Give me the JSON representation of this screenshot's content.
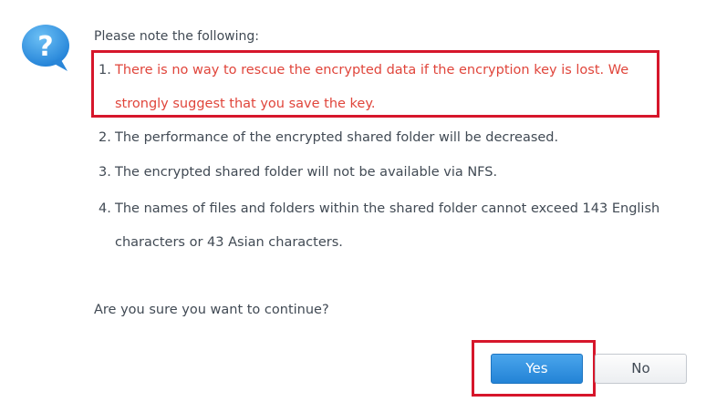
{
  "dialog": {
    "intro": "Please note the following:",
    "items": [
      {
        "num": "1.",
        "lines": [
          "There is no way to rescue the encrypted data if the encryption key is lost. We",
          "strongly suggest that you save the key."
        ]
      },
      {
        "num": "2.",
        "lines": [
          "The performance of the encrypted shared folder will be decreased."
        ]
      },
      {
        "num": "3.",
        "lines": [
          "The encrypted shared folder will not be available via NFS."
        ]
      },
      {
        "num": "4.",
        "lines": [
          "The names of files and folders within the shared folder cannot exceed 143 English",
          "characters or 43 Asian characters."
        ]
      }
    ],
    "confirm": "Are you sure you want to continue?",
    "yes_label": "Yes",
    "no_label": "No"
  },
  "icons": {
    "question": "question-icon"
  },
  "colors": {
    "warning_text": "#e0453b",
    "highlight_border": "#d6162b",
    "primary_button": "#2b8ad9",
    "text": "#414a54",
    "icon_blue": "#2f8fe0"
  }
}
